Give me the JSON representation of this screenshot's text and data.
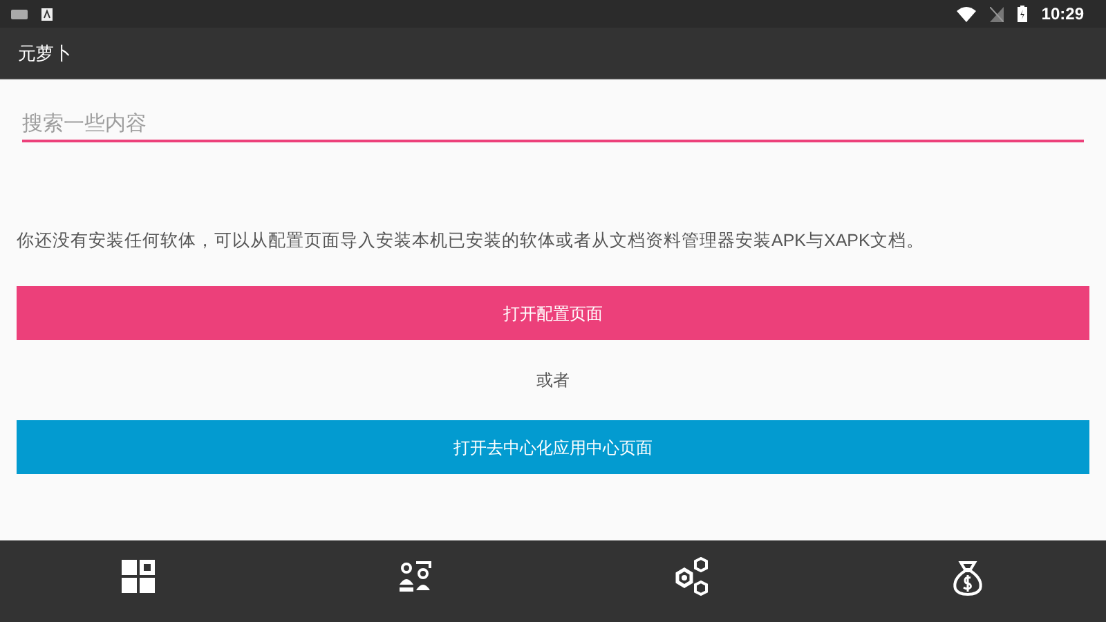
{
  "status_bar": {
    "time": "10:29"
  },
  "app_bar": {
    "title": "元萝卜"
  },
  "search": {
    "placeholder": "搜索一些内容"
  },
  "message": "你还没有安装任何软体，可以从配置页面导入安装本机已安装的软体或者从文档资料管理器安装APK与XAPK文档。",
  "primary_button": "打开配置页面",
  "separator": "或者",
  "secondary_button": "打开去中心化应用中心页面",
  "bottom_nav": [
    {
      "kind": "grid"
    },
    {
      "kind": "people"
    },
    {
      "kind": "hexagons"
    },
    {
      "kind": "moneybag"
    }
  ]
}
